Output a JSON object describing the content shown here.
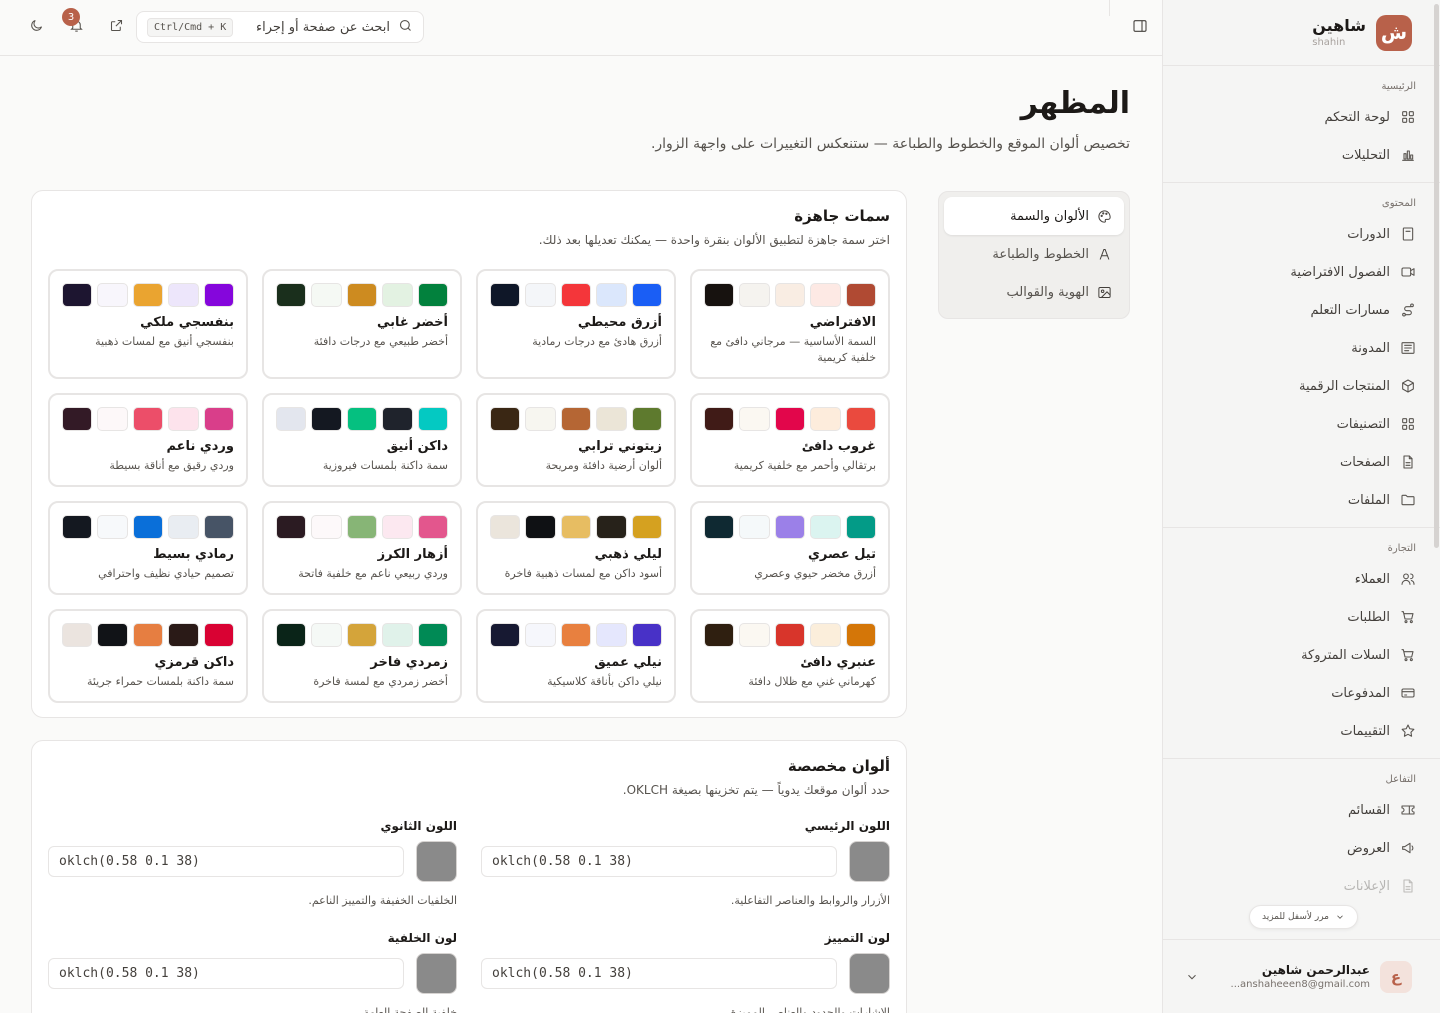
{
  "brand": {
    "name": "شاهين",
    "sub": "shahin",
    "logo": "ش"
  },
  "nav": [
    {
      "title": "الرئيسية",
      "items": [
        {
          "label": "لوحة التحكم",
          "icon": "grid-icon"
        },
        {
          "label": "التحليلات",
          "icon": "chart-icon"
        }
      ]
    },
    {
      "title": "المحتوى",
      "items": [
        {
          "label": "الدورات",
          "icon": "book-icon"
        },
        {
          "label": "الفصول الافتراضية",
          "icon": "video-icon"
        },
        {
          "label": "مسارات التعلم",
          "icon": "route-icon"
        },
        {
          "label": "المدونة",
          "icon": "newspaper-icon"
        },
        {
          "label": "المنتجات الرقمية",
          "icon": "package-icon"
        },
        {
          "label": "التصنيفات",
          "icon": "grid-icon"
        },
        {
          "label": "الصفحات",
          "icon": "file-icon"
        },
        {
          "label": "الملفات",
          "icon": "folder-icon"
        }
      ]
    },
    {
      "title": "التجارة",
      "items": [
        {
          "label": "العملاء",
          "icon": "users-icon"
        },
        {
          "label": "الطلبات",
          "icon": "cart-icon"
        },
        {
          "label": "السلات المتروكة",
          "icon": "cart-icon"
        },
        {
          "label": "المدفوعات",
          "icon": "card-icon"
        },
        {
          "label": "التقييمات",
          "icon": "star-icon"
        }
      ]
    },
    {
      "title": "التفاعل",
      "items": [
        {
          "label": "القسائم",
          "icon": "ticket-icon"
        },
        {
          "label": "العروض",
          "icon": "megaphone-icon"
        },
        {
          "label": "الإعلانات",
          "icon": "file-icon"
        }
      ]
    }
  ],
  "scroll_hint": "مرر لأسفل للمزيد",
  "user": {
    "name": "عبدالرحمن شاهين",
    "email": "...anshaheeen8@gmail.com",
    "initial": "ع"
  },
  "topbar": {
    "search_placeholder": "ابحث عن صفحة أو إجراء",
    "shortcut": "Ctrl/Cmd + K",
    "notifications": "3"
  },
  "page": {
    "title": "المظهر",
    "subtitle": "تخصيص ألوان الموقع والخطوط والطباعة — ستنعكس التغييرات على واجهة الزوار."
  },
  "tabs": [
    {
      "label": "الألوان والسمة",
      "icon": "palette-icon"
    },
    {
      "label": "الخطوط والطباعة",
      "icon": "font-icon"
    },
    {
      "label": "الهوية والقوالب",
      "icon": "image-icon"
    }
  ],
  "presets": {
    "title": "سمات جاهزة",
    "desc": "اختر سمة جاهزة لتطبيق الألوان بنقرة واحدة — يمكنك تعديلها بعد ذلك.",
    "themes": [
      {
        "name": "الافتراضي",
        "desc": "السمة الأساسية — مرجاني دافئ مع خلفية كريمية",
        "colors": [
          "#b04a33",
          "#fde9e4",
          "#f9ede3",
          "#f5f3ef",
          "#17120f"
        ]
      },
      {
        "name": "أزرق محيطي",
        "desc": "أزرق هادئ مع درجات رمادية",
        "colors": [
          "#1a5ef5",
          "#dbe7fc",
          "#f4363a",
          "#f4f6f9",
          "#0f1728"
        ]
      },
      {
        "name": "أخضر غابي",
        "desc": "أخضر طبيعي مع درجات دافئة",
        "colors": [
          "#02813d",
          "#e3f2e2",
          "#cd8b20",
          "#f5f9f4",
          "#1a2f1c"
        ]
      },
      {
        "name": "بنفسجي ملكي",
        "desc": "بنفسجي أنيق مع لمسات ذهبية",
        "colors": [
          "#8506dc",
          "#ede6fb",
          "#eaa430",
          "#f8f6fc",
          "#1d1530"
        ]
      },
      {
        "name": "غروب دافئ",
        "desc": "برتقالي وأحمر مع خلفية كريمية",
        "colors": [
          "#ea4a3e",
          "#fdecdc",
          "#e2064b",
          "#fbf8f2",
          "#401b17"
        ]
      },
      {
        "name": "زيتوني ترابي",
        "desc": "ألوان أرضية دافئة ومريحة",
        "colors": [
          "#5e7a2e",
          "#ebe5d7",
          "#b56634",
          "#f7f6f0",
          "#3a2714"
        ]
      },
      {
        "name": "داكن أنيق",
        "desc": "سمة داكنة بلمسات فيروزية",
        "colors": [
          "#04c9c2",
          "#1f232c",
          "#05c080",
          "#141821",
          "#e3e6ee"
        ]
      },
      {
        "name": "وردي ناعم",
        "desc": "وردي رقيق مع أناقة بسيطة",
        "colors": [
          "#d93e8a",
          "#fde3ec",
          "#ec4e69",
          "#fdf8f9",
          "#331a26"
        ]
      },
      {
        "name": "تيل عصري",
        "desc": "أزرق مخضر حيوي وعصري",
        "colors": [
          "#039b87",
          "#dbf4f0",
          "#9b80e8",
          "#f5f9fa",
          "#0f2932"
        ]
      },
      {
        "name": "ليلي ذهبي",
        "desc": "أسود داكن مع لمسات ذهبية فاخرة",
        "colors": [
          "#d5a120",
          "#27221a",
          "#e7bd62",
          "#0f1114",
          "#ebe5dc"
        ]
      },
      {
        "name": "أزهار الكرز",
        "desc": "وردي ربيعي ناعم مع خلفية فاتحة",
        "colors": [
          "#e3568d",
          "#fce8f0",
          "#87b576",
          "#fdf9fa",
          "#2b1b22"
        ]
      },
      {
        "name": "رمادي بسيط",
        "desc": "تصميم حيادي نظيف واحترافي",
        "colors": [
          "#475466",
          "#e9edf2",
          "#0a6fd9",
          "#f7f9fb",
          "#141820"
        ]
      },
      {
        "name": "عنبري دافئ",
        "desc": "كهرماني غني مع ظلال دافئة",
        "colors": [
          "#d47608",
          "#fbeedb",
          "#d8352b",
          "#fbf8f2",
          "#2f1f10"
        ]
      },
      {
        "name": "نيلي عميق",
        "desc": "نيلي داكن بأناقة كلاسيكية",
        "colors": [
          "#4831c7",
          "#e5e7fd",
          "#e8803f",
          "#f6f7fc",
          "#171932"
        ]
      },
      {
        "name": "زمردي فاخر",
        "desc": "أخضر زمردي مع لمسة فاخرة",
        "colors": [
          "#008a55",
          "#e0f2ea",
          "#d4a43a",
          "#f5f9f6",
          "#0a2418"
        ]
      },
      {
        "name": "داكن قرمزي",
        "desc": "سمة داكنة بلمسات حمراء جريئة",
        "colors": [
          "#d90233",
          "#2a1a17",
          "#e67e41",
          "#111317",
          "#ebe4df"
        ]
      }
    ]
  },
  "custom": {
    "title": "ألوان مخصصة",
    "desc": "حدد ألوان موقعك يدوياً — يتم تخزينها بصيغة OKLCH.",
    "fields": [
      {
        "label": "اللون الرئيسي",
        "value": "oklch(0.58 0.1 38)",
        "help": "الأزرار والروابط والعناصر التفاعلية."
      },
      {
        "label": "اللون الثانوي",
        "value": "oklch(0.58 0.1 38)",
        "help": "الخلفيات الخفيفة والتمييز الناعم."
      },
      {
        "label": "لون التمييز",
        "value": "oklch(0.58 0.1 38)",
        "help": "الإشارات والحدود والعناصر المميزة."
      },
      {
        "label": "لون الخلفية",
        "value": "oklch(0.58 0.1 38)",
        "help": "خلفية الصفحة العامة."
      }
    ]
  }
}
